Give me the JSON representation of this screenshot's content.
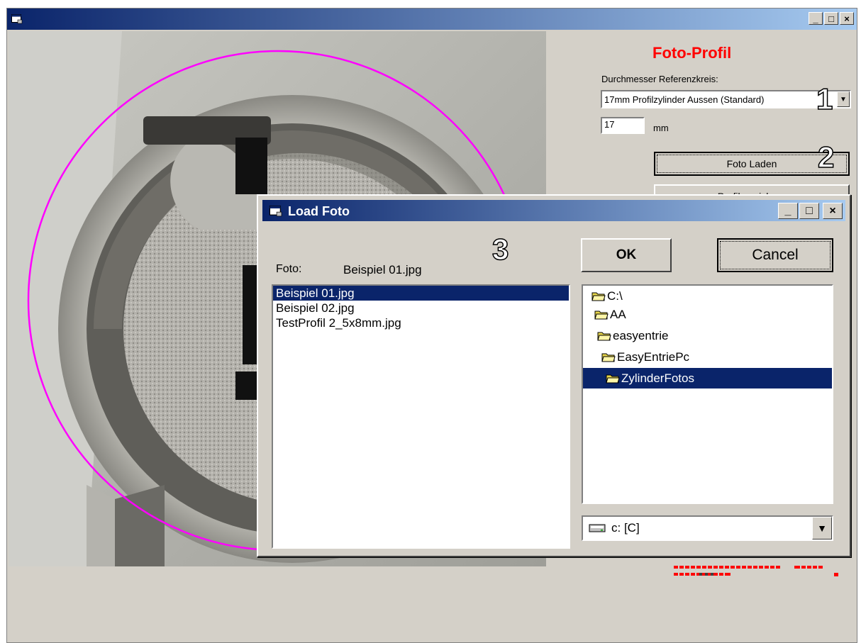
{
  "main_window": {
    "title": "",
    "minimize": "_",
    "maximize": "□",
    "close": "×"
  },
  "panel": {
    "title": "Foto-Profil",
    "diameter_label": "Durchmesser Referenzkreis:",
    "diameter_select": "17mm Profilzylinder Aussen (Standard)",
    "diameter_value": "17",
    "unit": "mm",
    "load_button": "Foto Laden",
    "second_button": "Profil speichern"
  },
  "callouts": [
    "1",
    "2",
    "3"
  ],
  "dialog": {
    "title": "Load Foto",
    "minimize": "_",
    "maximize": "□",
    "close": "×",
    "foto_label": "Foto:",
    "foto_value": "Beispiel 01.jpg",
    "ok": "OK",
    "cancel": "Cancel",
    "files": [
      "Beispiel 01.jpg",
      "Beispiel 02.jpg",
      "TestProfil 2_5x8mm.jpg"
    ],
    "selected_file_index": 0,
    "folders": [
      "C:\\",
      "AA",
      "easyentrie",
      "EasyEntriePc",
      "ZylinderFotos"
    ],
    "selected_folder_index": 4,
    "drive": "c: [C]"
  },
  "colors": {
    "title_active": "#0a246a",
    "title_gradient_end": "#a6caf0",
    "accent_red": "#ff0000",
    "circle": "#ff00ff",
    "face": "#d4d0c8"
  },
  "icons": {
    "app": "app-window-icon",
    "folder": "open-folder-icon",
    "drive": "disk-drive-icon"
  }
}
